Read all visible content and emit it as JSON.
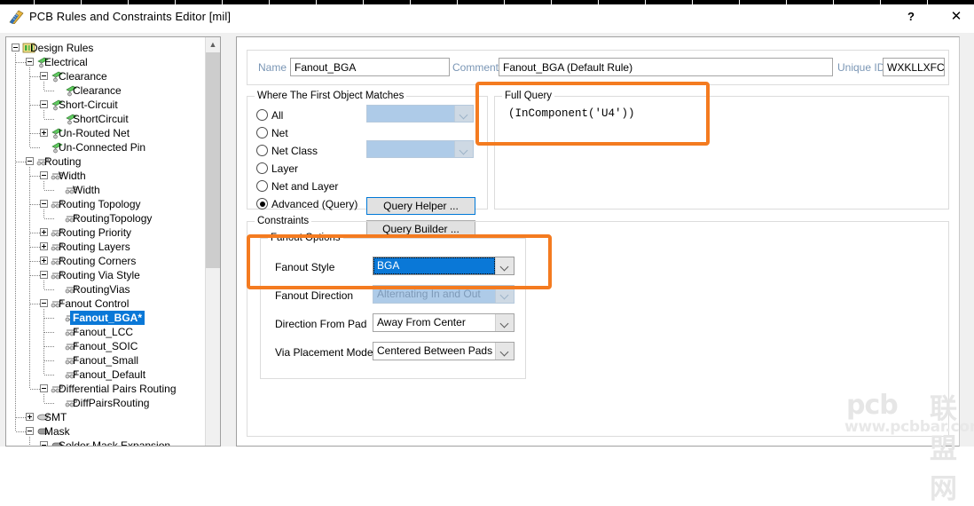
{
  "window": {
    "title": "PCB Rules and Constraints Editor [mil]",
    "icon": "ruler-icon",
    "help_label": "?",
    "close_label": "✕"
  },
  "tree": {
    "scroll_up_icon": "chevron-up-icon",
    "items": [
      {
        "label": "Design Rules",
        "depth": 0,
        "toggle": "minus",
        "icon": "folder-rules-icon",
        "selected": false
      },
      {
        "label": "Electrical",
        "depth": 1,
        "toggle": "minus",
        "icon": "electrical-icon",
        "selected": false
      },
      {
        "label": "Clearance",
        "depth": 2,
        "toggle": "minus",
        "icon": "electrical-icon",
        "selected": false
      },
      {
        "label": "Clearance",
        "depth": 3,
        "toggle": "none",
        "icon": "electrical-icon",
        "selected": false
      },
      {
        "label": "Short-Circuit",
        "depth": 2,
        "toggle": "minus",
        "icon": "electrical-icon",
        "selected": false
      },
      {
        "label": "ShortCircuit",
        "depth": 3,
        "toggle": "none",
        "icon": "electrical-icon",
        "selected": false
      },
      {
        "label": "Un-Routed Net",
        "depth": 2,
        "toggle": "plus",
        "icon": "electrical-icon",
        "selected": false
      },
      {
        "label": "Un-Connected Pin",
        "depth": 2,
        "toggle": "none",
        "icon": "electrical-icon",
        "selected": false
      },
      {
        "label": "Routing",
        "depth": 1,
        "toggle": "minus",
        "icon": "routing-icon",
        "selected": false
      },
      {
        "label": "Width",
        "depth": 2,
        "toggle": "minus",
        "icon": "routing-icon",
        "selected": false
      },
      {
        "label": "Width",
        "depth": 3,
        "toggle": "none",
        "icon": "routing-icon",
        "selected": false
      },
      {
        "label": "Routing Topology",
        "depth": 2,
        "toggle": "minus",
        "icon": "routing-icon",
        "selected": false
      },
      {
        "label": "RoutingTopology",
        "depth": 3,
        "toggle": "none",
        "icon": "routing-icon",
        "selected": false
      },
      {
        "label": "Routing Priority",
        "depth": 2,
        "toggle": "plus",
        "icon": "routing-icon",
        "selected": false
      },
      {
        "label": "Routing Layers",
        "depth": 2,
        "toggle": "plus",
        "icon": "routing-icon",
        "selected": false
      },
      {
        "label": "Routing Corners",
        "depth": 2,
        "toggle": "plus",
        "icon": "routing-icon",
        "selected": false
      },
      {
        "label": "Routing Via Style",
        "depth": 2,
        "toggle": "minus",
        "icon": "routing-icon",
        "selected": false
      },
      {
        "label": "RoutingVias",
        "depth": 3,
        "toggle": "none",
        "icon": "routing-icon",
        "selected": false
      },
      {
        "label": "Fanout Control",
        "depth": 2,
        "toggle": "minus",
        "icon": "routing-icon",
        "selected": false
      },
      {
        "label": "Fanout_BGA*",
        "depth": 3,
        "toggle": "none",
        "icon": "routing-icon",
        "selected": true
      },
      {
        "label": "Fanout_LCC",
        "depth": 3,
        "toggle": "none",
        "icon": "routing-icon",
        "selected": false
      },
      {
        "label": "Fanout_SOIC",
        "depth": 3,
        "toggle": "none",
        "icon": "routing-icon",
        "selected": false
      },
      {
        "label": "Fanout_Small",
        "depth": 3,
        "toggle": "none",
        "icon": "routing-icon",
        "selected": false
      },
      {
        "label": "Fanout_Default",
        "depth": 3,
        "toggle": "none",
        "icon": "routing-icon",
        "selected": false
      },
      {
        "label": "Differential Pairs Routing",
        "depth": 2,
        "toggle": "minus",
        "icon": "routing-icon",
        "selected": false
      },
      {
        "label": "DiffPairsRouting",
        "depth": 3,
        "toggle": "none",
        "icon": "routing-icon",
        "selected": false
      },
      {
        "label": "SMT",
        "depth": 1,
        "toggle": "plus",
        "icon": "smt-icon",
        "selected": false
      },
      {
        "label": "Mask",
        "depth": 1,
        "toggle": "minus",
        "icon": "mask-icon",
        "selected": false
      },
      {
        "label": "Solder Mask Expansion",
        "depth": 2,
        "toggle": "minus",
        "icon": "mask-icon",
        "selected": false
      }
    ]
  },
  "form": {
    "name_label": "Name",
    "name_value": "Fanout_BGA",
    "comment_label": "Comment",
    "comment_value": "Fanout_BGA (Default Rule)",
    "unique_id_label": "Unique ID",
    "unique_id_value": "WXKLLXFC"
  },
  "where_group": {
    "title": "Where The First Object Matches",
    "options": [
      {
        "label": "All",
        "selected": false
      },
      {
        "label": "Net",
        "selected": false
      },
      {
        "label": "Net Class",
        "selected": false
      },
      {
        "label": "Layer",
        "selected": false
      },
      {
        "label": "Net and Layer",
        "selected": false
      },
      {
        "label": "Advanced (Query)",
        "selected": true
      }
    ],
    "combo_net_value": "",
    "combo_netclass_value": "",
    "query_helper_label": "Query Helper ...",
    "query_builder_label": "Query Builder ..."
  },
  "full_query": {
    "title": "Full Query",
    "text": "(InComponent('U4'))"
  },
  "constraints": {
    "title": "Constraints",
    "fanout_options": {
      "title": "Fanout Options",
      "fields": [
        {
          "label": "Fanout Style",
          "value": "BGA",
          "disabled": false,
          "highlighted": true
        },
        {
          "label": "Fanout Direction",
          "value": "Alternating In and Out",
          "disabled": true,
          "highlighted": false
        },
        {
          "label": "Direction From Pad",
          "value": "Away From Center",
          "disabled": false,
          "highlighted": false
        },
        {
          "label": "Via Placement Mode",
          "value": "Centered Between Pads",
          "disabled": false,
          "highlighted": false
        }
      ]
    }
  },
  "highlights": {
    "accent_color": "#f47b20",
    "boxes": [
      "full-query-highlight",
      "fanout-style-highlight"
    ]
  },
  "watermark": {
    "brand": "pcb",
    "chinese": "联盟网",
    "url": "www.pcbbar.com"
  }
}
